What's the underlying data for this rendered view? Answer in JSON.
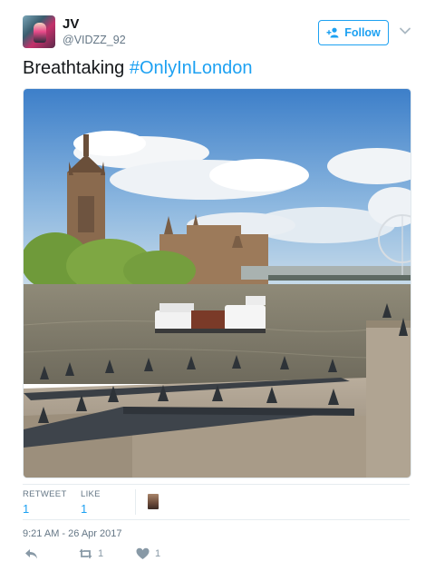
{
  "author": {
    "name": "JV",
    "handle": "@VIDZZ_92",
    "avatar_icon": "avatar"
  },
  "follow_button": {
    "label": "Follow",
    "icon": "add-user-icon"
  },
  "more_menu": {
    "icon": "chevron-down-icon"
  },
  "tweet": {
    "text": "Breathtaking ",
    "hashtag": "#OnlyInLondon"
  },
  "media": {
    "kind": "photo",
    "subject": "Houses of Parliament and London Eye across the River Thames"
  },
  "stats": {
    "retweets_label": "RETWEET",
    "retweets_count": "1",
    "likes_label": "LIKE",
    "likes_count": "1"
  },
  "timestamp": "9:21 AM - 26 Apr 2017",
  "actions": {
    "reply_icon": "reply-icon",
    "retweet_icon": "retweet-icon",
    "retweet_count": "1",
    "like_icon": "heart-icon",
    "like_count": "1"
  },
  "colors": {
    "accent": "#1da1f2",
    "secondary_text": "#657786",
    "primary_text": "#14171a"
  }
}
